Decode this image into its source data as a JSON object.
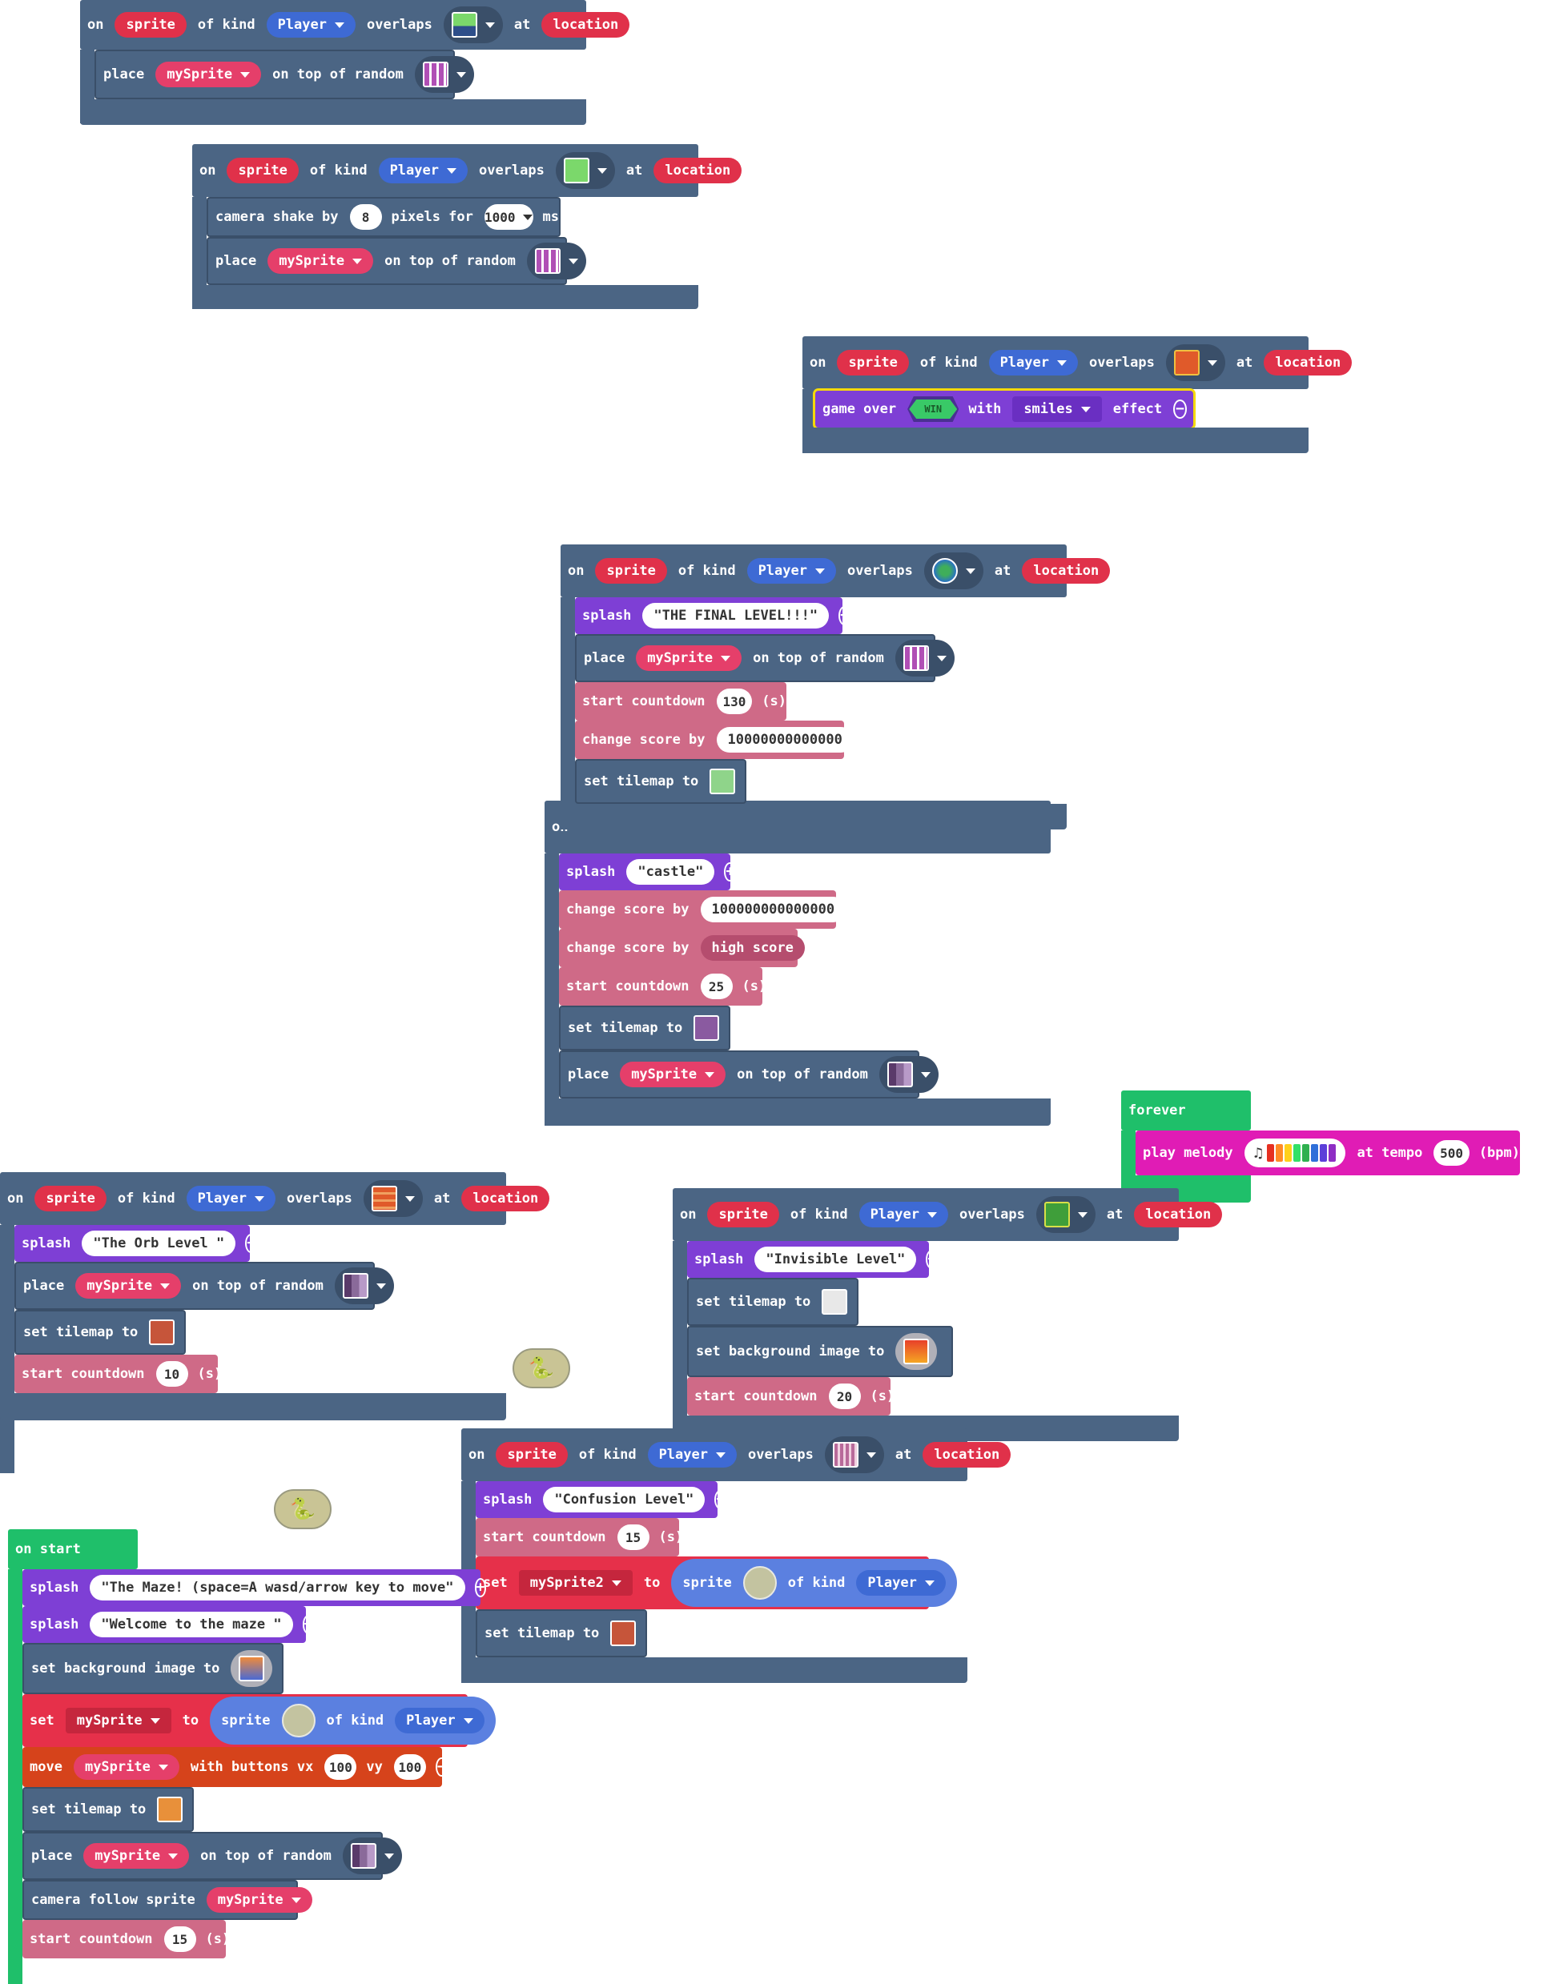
{
  "common": {
    "on": "on",
    "sprite": "sprite",
    "of_kind": "of kind",
    "player": "Player",
    "overlaps": "overlaps",
    "at": "at",
    "location": "location",
    "place": "place",
    "mySprite": "mySprite",
    "on_top_of_random": "on top of random",
    "splash": "splash",
    "start_countdown": "start countdown",
    "s_unit": "(s)",
    "change_score_by": "change score by",
    "set_tilemap_to": "set tilemap to"
  },
  "block1": {},
  "block2": {
    "camera_shake_by": "camera shake by",
    "shake_amount": "8",
    "pixels_for": "pixels for",
    "duration": "1000",
    "ms": "ms"
  },
  "block3": {
    "game_over": "game over",
    "win": "WIN",
    "with": "with",
    "effect_name": "smiles",
    "effect": "effect"
  },
  "block4": {
    "splash_text": "\"THE FINAL LEVEL!!!\"",
    "countdown": "130",
    "score": "10000000000000"
  },
  "block5": {
    "splash_text": "\"castle\"",
    "score": "100000000000000",
    "high_score": "high score",
    "countdown": "25"
  },
  "forever": {
    "label": "forever",
    "play_melody": "play melody",
    "at_tempo": "at tempo",
    "tempo": "500",
    "bpm": "(bpm)"
  },
  "block6": {
    "splash_text": "\"The Orb Level \"",
    "countdown": "10"
  },
  "block7": {
    "splash_text": "\"Invisible Level\"",
    "set_background_image_to": "set background image to",
    "countdown": "20"
  },
  "block8": {
    "splash_text": "\"Confusion Level\"",
    "countdown": "15",
    "set": "set",
    "var": "mySprite2",
    "to": "to"
  },
  "onstart": {
    "label": "on start",
    "splash1": "\"The Maze! (space=A wasd/arrow key to move\"",
    "splash2": "\"Welcome to the maze \"",
    "set_background_image_to": "set background image to",
    "set": "set",
    "to": "to",
    "move": "move",
    "with_buttons": "with buttons vx",
    "vx": "100",
    "vy_label": "vy",
    "vy": "100",
    "camera_follow": "camera follow sprite",
    "countdown": "15"
  },
  "colors": {
    "event": "#4b6584",
    "splash": "#7e3fd5",
    "info": "#cf6a87",
    "set": "#e6304a",
    "move": "#d6431b",
    "music": "#e01cb5",
    "loop": "#1fbf6a",
    "highlight": "#f5d90a"
  },
  "melody_colors": [
    "#e63022",
    "#ff8b27",
    "#ffd01b",
    "#33e067",
    "#2fb04f",
    "#2f6fd9",
    "#5c3fd9",
    "#8e2ec4"
  ]
}
